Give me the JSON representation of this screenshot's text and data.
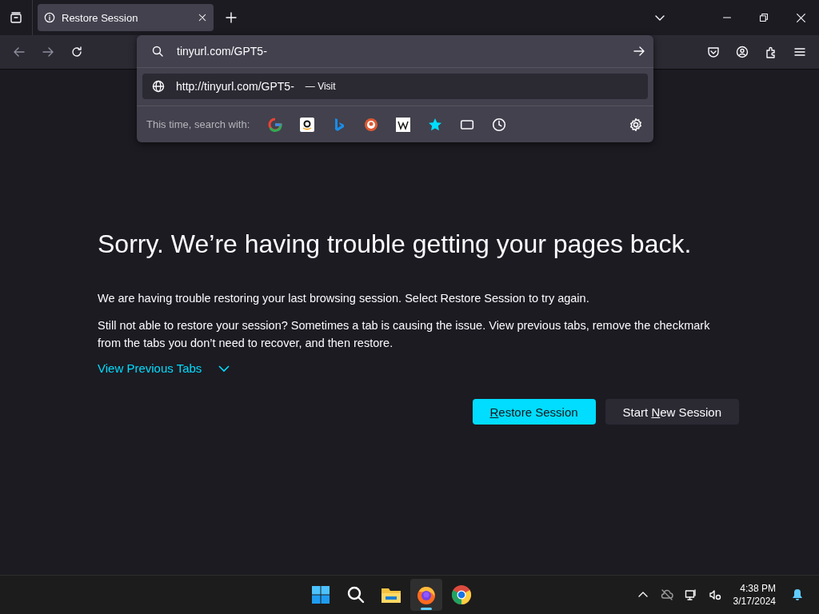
{
  "tabs": [
    {
      "title": "Restore Session",
      "selected": true
    }
  ],
  "urlbar": {
    "value": "tinyurl.com/GPT5-",
    "result": {
      "url": "http://tinyurl.com/GPT5-",
      "action": "— Visit",
      "selected": true
    },
    "search_with_label": "This time, search with:"
  },
  "page": {
    "heading": "Sorry. We’re having trouble getting your pages back.",
    "paragraphs": [
      "We are having trouble restoring your last browsing session. Select Restore Session to try again.",
      "Still not able to restore your session? Sometimes a tab is causing the issue. View previous tabs, remove the checkmark from the tabs you don’t need to recover, and then restore."
    ],
    "toggle": {
      "label": "View Previous Tabs",
      "expanded": false
    },
    "buttons": [
      {
        "kind": "primary",
        "access_key": "R",
        "rest": "estore Session"
      },
      {
        "kind": "secondary",
        "lead": "Start ",
        "access_key": "N",
        "rest": "ew Session"
      }
    ]
  },
  "taskbar": {
    "apps": [
      {
        "kind": "start",
        "active": false
      },
      {
        "kind": "search",
        "active": false
      },
      {
        "kind": "files",
        "active": false
      },
      {
        "kind": "firefox",
        "active": true
      },
      {
        "kind": "chrome",
        "active": false
      }
    ],
    "time": "4:38 PM",
    "date": "3/17/2024"
  }
}
